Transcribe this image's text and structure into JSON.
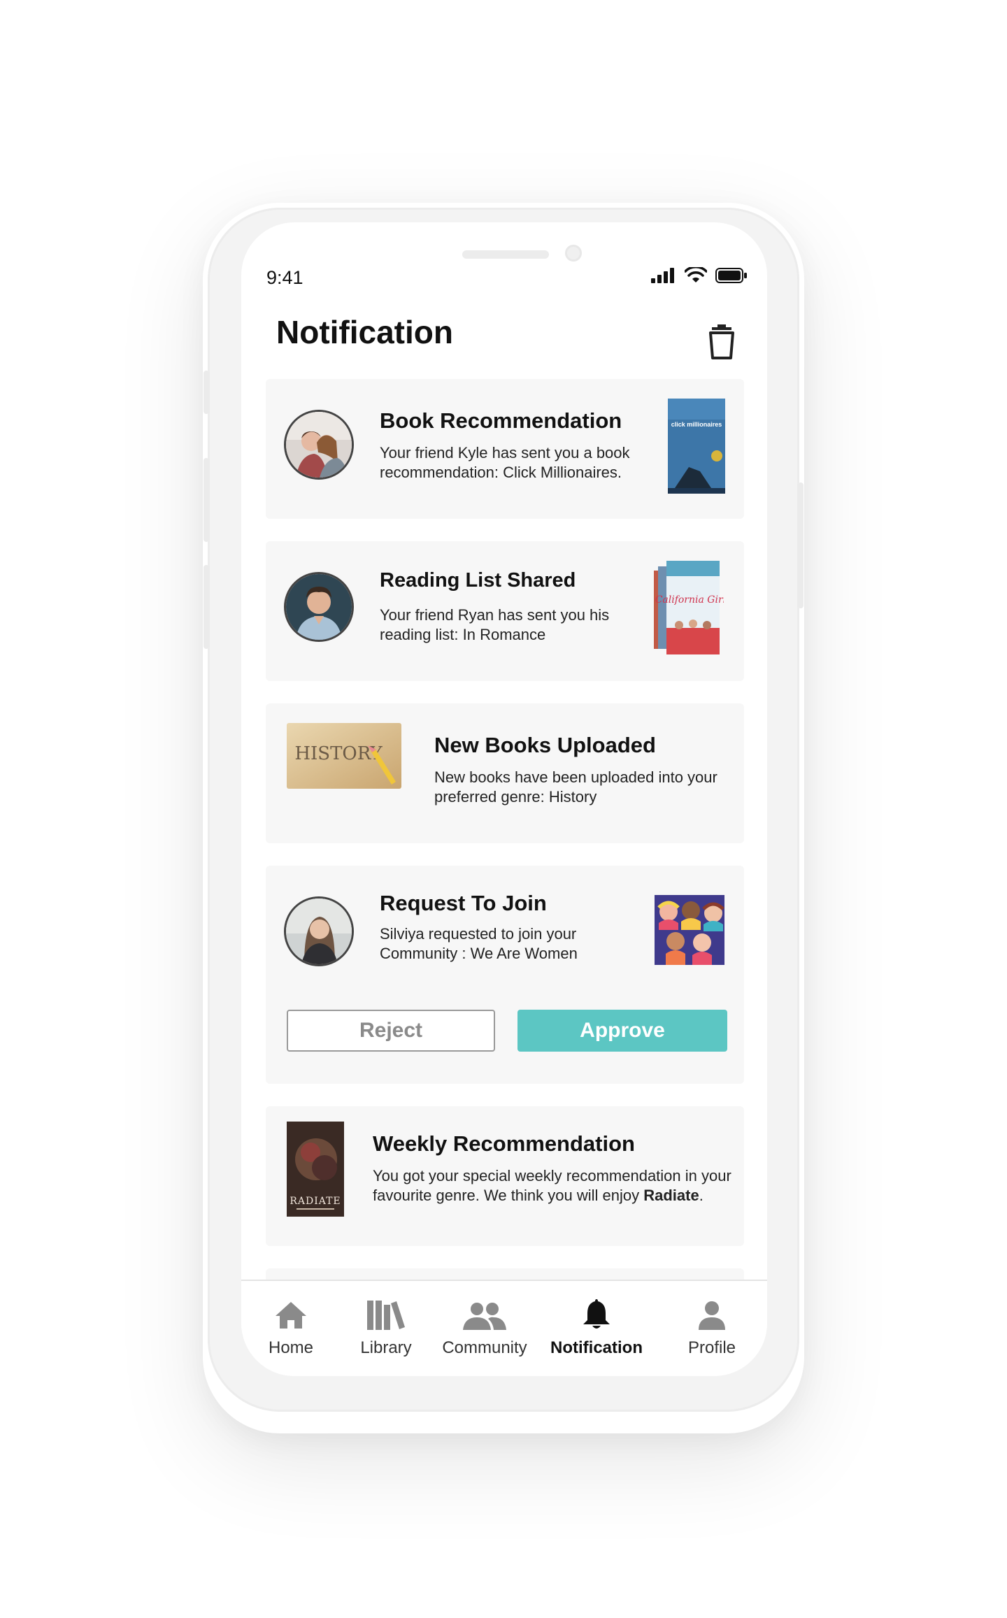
{
  "status_bar": {
    "time": "9:41"
  },
  "header": {
    "title": "Notification"
  },
  "notifications": [
    {
      "title": "Book Recommendation",
      "text": "Your friend Kyle has sent you a book recommendation: Click Millionaires.",
      "thumb_text": "click millionaires"
    },
    {
      "title": "Reading List Shared",
      "text": "Your friend Ryan has sent you his reading list: In Romance",
      "thumb_text": "California Girls"
    },
    {
      "title": "New Books Uploaded",
      "text": "New books have been uploaded into your preferred genre: History",
      "thumb_text": "HISTORY"
    },
    {
      "title": "Request To Join",
      "text": "Silviya requested to join your Community : We Are Women",
      "reject_label": "Reject",
      "approve_label": "Approve"
    },
    {
      "title": "Weekly Recommendation",
      "text_before": "You got your special weekly recommendation in your favourite genre. We think you will enjoy",
      "text_bold": "Radiate",
      "text_after": ".",
      "thumb_text": "RADIATE"
    }
  ],
  "tabbar": {
    "items": [
      {
        "label": "Home",
        "icon": "home-icon"
      },
      {
        "label": "Library",
        "icon": "library-icon"
      },
      {
        "label": "Community",
        "icon": "community-icon"
      },
      {
        "label": "Notification",
        "icon": "bell-icon",
        "active": true
      },
      {
        "label": "Profile",
        "icon": "profile-icon"
      }
    ]
  },
  "colors": {
    "accent": "#5cc6c3",
    "card_bg": "#f7f7f7",
    "text": "#111111"
  }
}
